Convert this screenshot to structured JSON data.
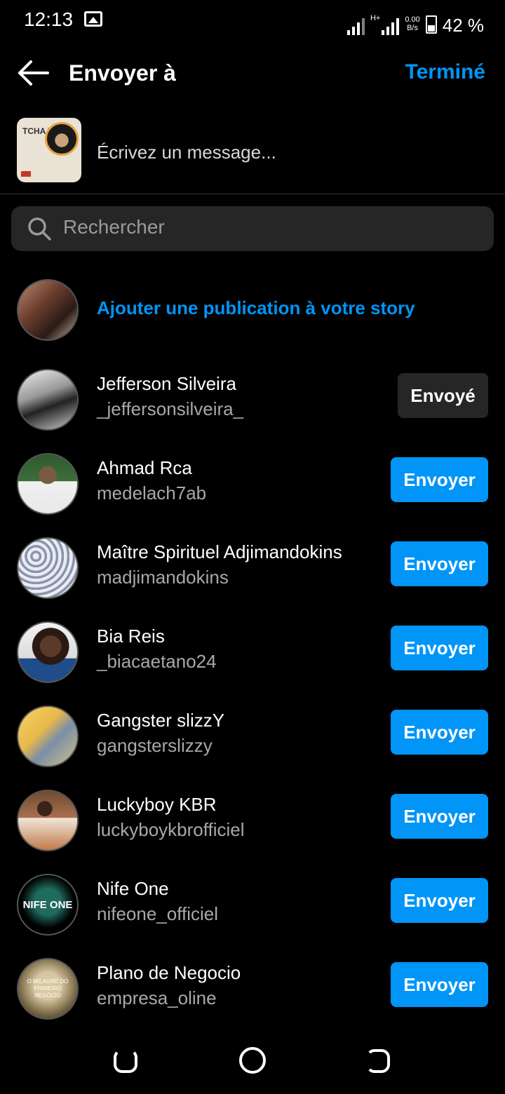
{
  "status_bar": {
    "time": "12:13",
    "network_type": "H+",
    "net_speed_value": "0.00",
    "net_speed_unit": "B/s",
    "battery_percent": "42 %"
  },
  "header": {
    "title": "Envoyer à",
    "done_label": "Terminé"
  },
  "compose": {
    "thumbnail_text": "TCHA TCHA",
    "message_placeholder": "Écrivez un message..."
  },
  "search": {
    "placeholder": "Rechercher"
  },
  "story": {
    "label": "Ajouter une publication à votre story"
  },
  "contacts": [
    {
      "name": "Jefferson Silveira",
      "username": "_jeffersonsilveira_",
      "button": "Envoyé",
      "sent": true
    },
    {
      "name": "Ahmad Rca",
      "username": "medelach7ab",
      "button": "Envoyer",
      "sent": false
    },
    {
      "name": "Maître Spirituel Adjimandokins",
      "username": "madjimandokins",
      "button": "Envoyer",
      "sent": false
    },
    {
      "name": "Bia Reis",
      "username": "_biacaetano24",
      "button": "Envoyer",
      "sent": false
    },
    {
      "name": "Gangster slizzY",
      "username": "gangsterslizzy",
      "button": "Envoyer",
      "sent": false
    },
    {
      "name": "Luckyboy KBR",
      "username": "luckyboykbrofficiel",
      "button": "Envoyer",
      "sent": false
    },
    {
      "name": "Nife One",
      "username": "nifeone_officiel",
      "button": "Envoyer",
      "sent": false
    },
    {
      "name": "Plano de Negocio",
      "username": "empresa_oline",
      "button": "Envoyer",
      "sent": false
    }
  ],
  "avatar_texts": {
    "nife_one": "NIFE ONE",
    "plano": "O MILAGRE DO PRIMEIRO NEGÓCIO"
  },
  "colors": {
    "accent": "#0095f6",
    "background": "#000000",
    "secondary_text": "#a8a8a8",
    "sent_button": "#262626"
  }
}
